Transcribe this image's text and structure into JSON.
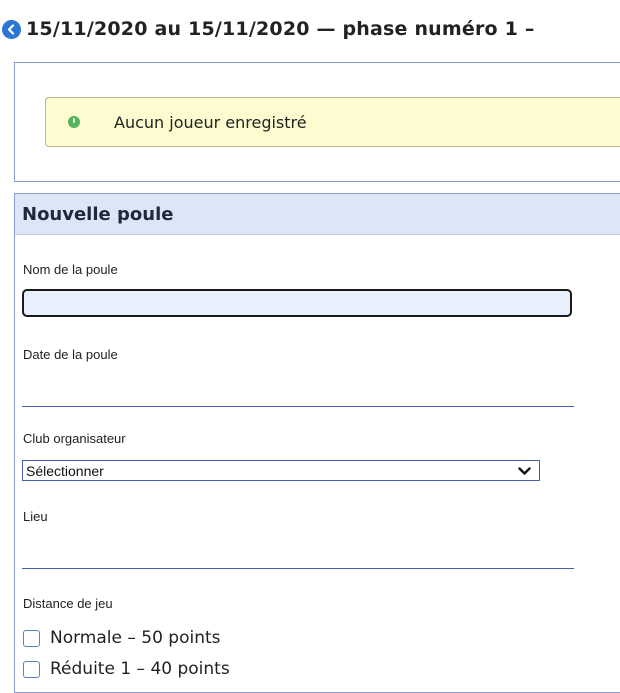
{
  "header": {
    "title": "15/11/2020 au 15/11/2020 — phase numéro 1 –"
  },
  "alert": {
    "message": "Aucun joueur enregistré"
  },
  "form": {
    "section_title": "Nouvelle poule",
    "name_label": "Nom de la poule",
    "name_value": "",
    "date_label": "Date de la poule",
    "date_value": "",
    "club_label": "Club organisateur",
    "club_selected": "Sélectionner",
    "lieu_label": "Lieu",
    "lieu_value": "",
    "distance_label": "Distance de jeu",
    "distance_options": [
      {
        "label": "Normale – 50 points",
        "checked": false
      },
      {
        "label": "Réduite 1 – 40 points",
        "checked": false
      }
    ]
  },
  "colors": {
    "accent": "#2a78d4",
    "section_header_bg": "#dbe6f6",
    "alert_bg": "#fdfcd0",
    "alert_icon": "#56b35c",
    "border": "#8a9ed4"
  },
  "icons": {
    "back": "back-arrow-circle-icon",
    "alert": "info-dot-icon",
    "select": "chevron-down-icon"
  }
}
